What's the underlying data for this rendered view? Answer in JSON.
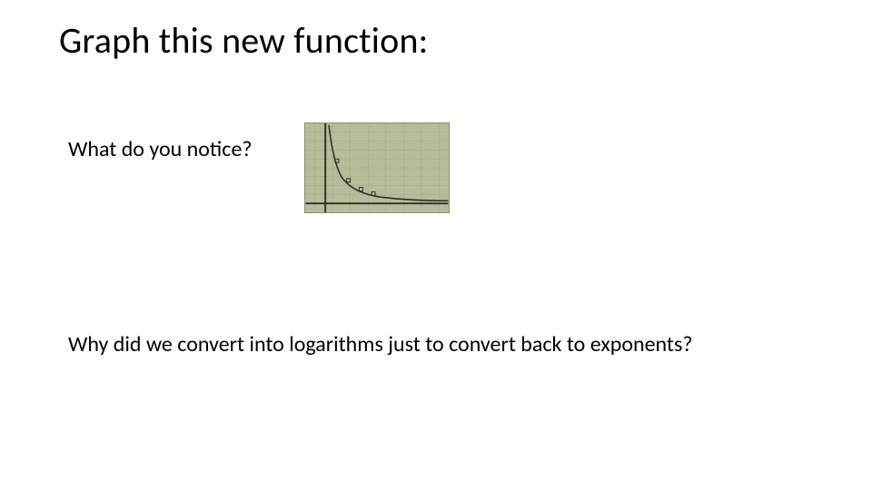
{
  "title": "Graph this new function:",
  "question1": "What do you notice?",
  "question2": "Why did we convert into logarithms just to convert back to exponents?",
  "chart_data": {
    "type": "line",
    "title": "",
    "xlabel": "",
    "ylabel": "",
    "xlim": [
      0,
      10
    ],
    "ylim": [
      0,
      10
    ],
    "series": [
      {
        "name": "curve",
        "x": [
          0.3,
          0.6,
          1,
          1.5,
          2,
          3,
          4,
          5,
          6,
          7,
          8,
          9,
          10
        ],
        "y": [
          10,
          7,
          5,
          3.3,
          2.5,
          1.6,
          1.2,
          1.0,
          0.85,
          0.73,
          0.65,
          0.58,
          0.52
        ]
      }
    ],
    "markers": [
      {
        "x": 1.0,
        "y": 5.0
      },
      {
        "x": 2.0,
        "y": 2.5
      },
      {
        "x": 3.0,
        "y": 1.6
      },
      {
        "x": 4.0,
        "y": 1.2
      }
    ]
  }
}
